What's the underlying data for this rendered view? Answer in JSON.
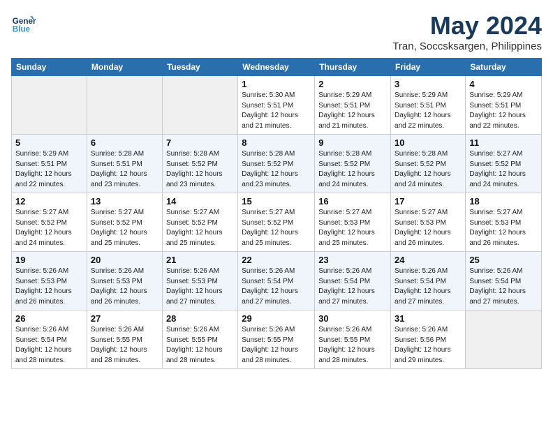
{
  "header": {
    "logo_line1": "General",
    "logo_line2": "Blue",
    "title": "May 2024",
    "subtitle": "Tran, Soccsksargen, Philippines"
  },
  "days_of_week": [
    "Sunday",
    "Monday",
    "Tuesday",
    "Wednesday",
    "Thursday",
    "Friday",
    "Saturday"
  ],
  "weeks": [
    [
      {
        "num": "",
        "info": ""
      },
      {
        "num": "",
        "info": ""
      },
      {
        "num": "",
        "info": ""
      },
      {
        "num": "1",
        "info": "Sunrise: 5:30 AM\nSunset: 5:51 PM\nDaylight: 12 hours\nand 21 minutes."
      },
      {
        "num": "2",
        "info": "Sunrise: 5:29 AM\nSunset: 5:51 PM\nDaylight: 12 hours\nand 21 minutes."
      },
      {
        "num": "3",
        "info": "Sunrise: 5:29 AM\nSunset: 5:51 PM\nDaylight: 12 hours\nand 22 minutes."
      },
      {
        "num": "4",
        "info": "Sunrise: 5:29 AM\nSunset: 5:51 PM\nDaylight: 12 hours\nand 22 minutes."
      }
    ],
    [
      {
        "num": "5",
        "info": "Sunrise: 5:29 AM\nSunset: 5:51 PM\nDaylight: 12 hours\nand 22 minutes."
      },
      {
        "num": "6",
        "info": "Sunrise: 5:28 AM\nSunset: 5:51 PM\nDaylight: 12 hours\nand 23 minutes."
      },
      {
        "num": "7",
        "info": "Sunrise: 5:28 AM\nSunset: 5:52 PM\nDaylight: 12 hours\nand 23 minutes."
      },
      {
        "num": "8",
        "info": "Sunrise: 5:28 AM\nSunset: 5:52 PM\nDaylight: 12 hours\nand 23 minutes."
      },
      {
        "num": "9",
        "info": "Sunrise: 5:28 AM\nSunset: 5:52 PM\nDaylight: 12 hours\nand 24 minutes."
      },
      {
        "num": "10",
        "info": "Sunrise: 5:28 AM\nSunset: 5:52 PM\nDaylight: 12 hours\nand 24 minutes."
      },
      {
        "num": "11",
        "info": "Sunrise: 5:27 AM\nSunset: 5:52 PM\nDaylight: 12 hours\nand 24 minutes."
      }
    ],
    [
      {
        "num": "12",
        "info": "Sunrise: 5:27 AM\nSunset: 5:52 PM\nDaylight: 12 hours\nand 24 minutes."
      },
      {
        "num": "13",
        "info": "Sunrise: 5:27 AM\nSunset: 5:52 PM\nDaylight: 12 hours\nand 25 minutes."
      },
      {
        "num": "14",
        "info": "Sunrise: 5:27 AM\nSunset: 5:52 PM\nDaylight: 12 hours\nand 25 minutes."
      },
      {
        "num": "15",
        "info": "Sunrise: 5:27 AM\nSunset: 5:52 PM\nDaylight: 12 hours\nand 25 minutes."
      },
      {
        "num": "16",
        "info": "Sunrise: 5:27 AM\nSunset: 5:53 PM\nDaylight: 12 hours\nand 25 minutes."
      },
      {
        "num": "17",
        "info": "Sunrise: 5:27 AM\nSunset: 5:53 PM\nDaylight: 12 hours\nand 26 minutes."
      },
      {
        "num": "18",
        "info": "Sunrise: 5:27 AM\nSunset: 5:53 PM\nDaylight: 12 hours\nand 26 minutes."
      }
    ],
    [
      {
        "num": "19",
        "info": "Sunrise: 5:26 AM\nSunset: 5:53 PM\nDaylight: 12 hours\nand 26 minutes."
      },
      {
        "num": "20",
        "info": "Sunrise: 5:26 AM\nSunset: 5:53 PM\nDaylight: 12 hours\nand 26 minutes."
      },
      {
        "num": "21",
        "info": "Sunrise: 5:26 AM\nSunset: 5:53 PM\nDaylight: 12 hours\nand 27 minutes."
      },
      {
        "num": "22",
        "info": "Sunrise: 5:26 AM\nSunset: 5:54 PM\nDaylight: 12 hours\nand 27 minutes."
      },
      {
        "num": "23",
        "info": "Sunrise: 5:26 AM\nSunset: 5:54 PM\nDaylight: 12 hours\nand 27 minutes."
      },
      {
        "num": "24",
        "info": "Sunrise: 5:26 AM\nSunset: 5:54 PM\nDaylight: 12 hours\nand 27 minutes."
      },
      {
        "num": "25",
        "info": "Sunrise: 5:26 AM\nSunset: 5:54 PM\nDaylight: 12 hours\nand 27 minutes."
      }
    ],
    [
      {
        "num": "26",
        "info": "Sunrise: 5:26 AM\nSunset: 5:54 PM\nDaylight: 12 hours\nand 28 minutes."
      },
      {
        "num": "27",
        "info": "Sunrise: 5:26 AM\nSunset: 5:55 PM\nDaylight: 12 hours\nand 28 minutes."
      },
      {
        "num": "28",
        "info": "Sunrise: 5:26 AM\nSunset: 5:55 PM\nDaylight: 12 hours\nand 28 minutes."
      },
      {
        "num": "29",
        "info": "Sunrise: 5:26 AM\nSunset: 5:55 PM\nDaylight: 12 hours\nand 28 minutes."
      },
      {
        "num": "30",
        "info": "Sunrise: 5:26 AM\nSunset: 5:55 PM\nDaylight: 12 hours\nand 28 minutes."
      },
      {
        "num": "31",
        "info": "Sunrise: 5:26 AM\nSunset: 5:56 PM\nDaylight: 12 hours\nand 29 minutes."
      },
      {
        "num": "",
        "info": ""
      }
    ]
  ]
}
